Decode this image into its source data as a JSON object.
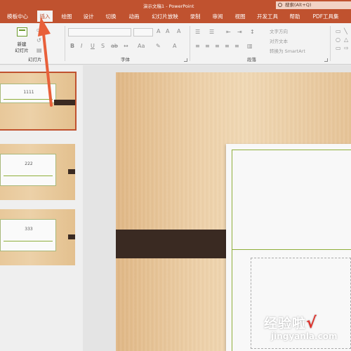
{
  "window": {
    "title": "演示文稿1  -  PowerPoint",
    "search_label": "搜索(Alt+Q)"
  },
  "menu": {
    "tabs": [
      {
        "label": "模板中心"
      },
      {
        "label": "插入",
        "active": true
      },
      {
        "label": "绘图"
      },
      {
        "label": "设计"
      },
      {
        "label": "切换"
      },
      {
        "label": "动画"
      },
      {
        "label": "幻灯片放映"
      },
      {
        "label": "录制"
      },
      {
        "label": "审阅"
      },
      {
        "label": "视图"
      },
      {
        "label": "开发工具"
      },
      {
        "label": "帮助"
      },
      {
        "label": "PDF工具集"
      }
    ]
  },
  "ribbon": {
    "slides_group": {
      "label": "幻灯片",
      "new_slide_label": "新建\n幻灯片"
    },
    "font_group": {
      "label": "字体"
    },
    "paragraph_group": {
      "label": "段落"
    },
    "text_direction": "文字方向",
    "align_text": "对齐文本",
    "convert_smartart": "转换为 SmartArt",
    "font_buttons": [
      "B",
      "I",
      "U",
      "S",
      "ab"
    ]
  },
  "thumbnails": [
    {
      "number_text": "1111",
      "selected": true
    },
    {
      "number_text": "222",
      "selected": false
    },
    {
      "number_text": "333",
      "selected": false
    }
  ],
  "watermark": {
    "main": "经验啦",
    "check": "√",
    "sub": "jingyanla.com"
  },
  "colors": {
    "accent": "#c0522f",
    "wood_light": "#f0d8b4",
    "dark_bar": "#3a2a22",
    "green_line": "#8fae3a",
    "arrow": "#e8603a"
  }
}
